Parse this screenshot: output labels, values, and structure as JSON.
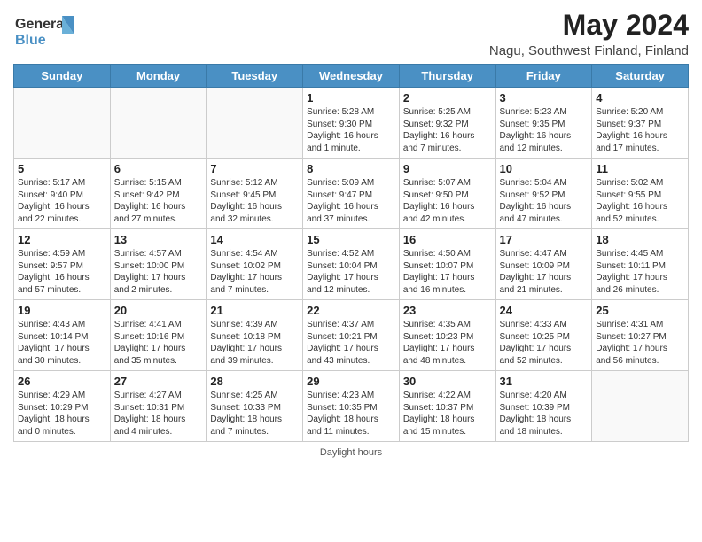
{
  "header": {
    "logo_line1": "General",
    "logo_line2": "Blue",
    "title": "May 2024",
    "subtitle": "Nagu, Southwest Finland, Finland"
  },
  "calendar": {
    "days_of_week": [
      "Sunday",
      "Monday",
      "Tuesday",
      "Wednesday",
      "Thursday",
      "Friday",
      "Saturday"
    ],
    "weeks": [
      [
        {
          "day": "",
          "info": ""
        },
        {
          "day": "",
          "info": ""
        },
        {
          "day": "",
          "info": ""
        },
        {
          "day": "1",
          "info": "Sunrise: 5:28 AM\nSunset: 9:30 PM\nDaylight: 16 hours\nand 1 minute."
        },
        {
          "day": "2",
          "info": "Sunrise: 5:25 AM\nSunset: 9:32 PM\nDaylight: 16 hours\nand 7 minutes."
        },
        {
          "day": "3",
          "info": "Sunrise: 5:23 AM\nSunset: 9:35 PM\nDaylight: 16 hours\nand 12 minutes."
        },
        {
          "day": "4",
          "info": "Sunrise: 5:20 AM\nSunset: 9:37 PM\nDaylight: 16 hours\nand 17 minutes."
        }
      ],
      [
        {
          "day": "5",
          "info": "Sunrise: 5:17 AM\nSunset: 9:40 PM\nDaylight: 16 hours\nand 22 minutes."
        },
        {
          "day": "6",
          "info": "Sunrise: 5:15 AM\nSunset: 9:42 PM\nDaylight: 16 hours\nand 27 minutes."
        },
        {
          "day": "7",
          "info": "Sunrise: 5:12 AM\nSunset: 9:45 PM\nDaylight: 16 hours\nand 32 minutes."
        },
        {
          "day": "8",
          "info": "Sunrise: 5:09 AM\nSunset: 9:47 PM\nDaylight: 16 hours\nand 37 minutes."
        },
        {
          "day": "9",
          "info": "Sunrise: 5:07 AM\nSunset: 9:50 PM\nDaylight: 16 hours\nand 42 minutes."
        },
        {
          "day": "10",
          "info": "Sunrise: 5:04 AM\nSunset: 9:52 PM\nDaylight: 16 hours\nand 47 minutes."
        },
        {
          "day": "11",
          "info": "Sunrise: 5:02 AM\nSunset: 9:55 PM\nDaylight: 16 hours\nand 52 minutes."
        }
      ],
      [
        {
          "day": "12",
          "info": "Sunrise: 4:59 AM\nSunset: 9:57 PM\nDaylight: 16 hours\nand 57 minutes."
        },
        {
          "day": "13",
          "info": "Sunrise: 4:57 AM\nSunset: 10:00 PM\nDaylight: 17 hours\nand 2 minutes."
        },
        {
          "day": "14",
          "info": "Sunrise: 4:54 AM\nSunset: 10:02 PM\nDaylight: 17 hours\nand 7 minutes."
        },
        {
          "day": "15",
          "info": "Sunrise: 4:52 AM\nSunset: 10:04 PM\nDaylight: 17 hours\nand 12 minutes."
        },
        {
          "day": "16",
          "info": "Sunrise: 4:50 AM\nSunset: 10:07 PM\nDaylight: 17 hours\nand 16 minutes."
        },
        {
          "day": "17",
          "info": "Sunrise: 4:47 AM\nSunset: 10:09 PM\nDaylight: 17 hours\nand 21 minutes."
        },
        {
          "day": "18",
          "info": "Sunrise: 4:45 AM\nSunset: 10:11 PM\nDaylight: 17 hours\nand 26 minutes."
        }
      ],
      [
        {
          "day": "19",
          "info": "Sunrise: 4:43 AM\nSunset: 10:14 PM\nDaylight: 17 hours\nand 30 minutes."
        },
        {
          "day": "20",
          "info": "Sunrise: 4:41 AM\nSunset: 10:16 PM\nDaylight: 17 hours\nand 35 minutes."
        },
        {
          "day": "21",
          "info": "Sunrise: 4:39 AM\nSunset: 10:18 PM\nDaylight: 17 hours\nand 39 minutes."
        },
        {
          "day": "22",
          "info": "Sunrise: 4:37 AM\nSunset: 10:21 PM\nDaylight: 17 hours\nand 43 minutes."
        },
        {
          "day": "23",
          "info": "Sunrise: 4:35 AM\nSunset: 10:23 PM\nDaylight: 17 hours\nand 48 minutes."
        },
        {
          "day": "24",
          "info": "Sunrise: 4:33 AM\nSunset: 10:25 PM\nDaylight: 17 hours\nand 52 minutes."
        },
        {
          "day": "25",
          "info": "Sunrise: 4:31 AM\nSunset: 10:27 PM\nDaylight: 17 hours\nand 56 minutes."
        }
      ],
      [
        {
          "day": "26",
          "info": "Sunrise: 4:29 AM\nSunset: 10:29 PM\nDaylight: 18 hours\nand 0 minutes."
        },
        {
          "day": "27",
          "info": "Sunrise: 4:27 AM\nSunset: 10:31 PM\nDaylight: 18 hours\nand 4 minutes."
        },
        {
          "day": "28",
          "info": "Sunrise: 4:25 AM\nSunset: 10:33 PM\nDaylight: 18 hours\nand 7 minutes."
        },
        {
          "day": "29",
          "info": "Sunrise: 4:23 AM\nSunset: 10:35 PM\nDaylight: 18 hours\nand 11 minutes."
        },
        {
          "day": "30",
          "info": "Sunrise: 4:22 AM\nSunset: 10:37 PM\nDaylight: 18 hours\nand 15 minutes."
        },
        {
          "day": "31",
          "info": "Sunrise: 4:20 AM\nSunset: 10:39 PM\nDaylight: 18 hours\nand 18 minutes."
        },
        {
          "day": "",
          "info": ""
        }
      ]
    ]
  },
  "footer": {
    "text": "Daylight hours"
  }
}
